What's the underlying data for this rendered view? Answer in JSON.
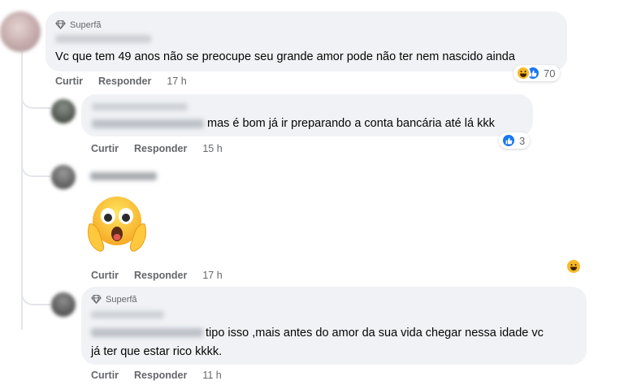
{
  "comments": [
    {
      "badge": "Superfã",
      "text": "Vc que tem 49 anos não se preocupe seu grande amor pode não ter nem nascido ainda",
      "actions": {
        "like": "Curtir",
        "reply": "Responder",
        "time": "17 h"
      },
      "reactions": {
        "icons": [
          "haha-icon",
          "like-icon"
        ],
        "count": "70"
      }
    },
    {
      "text": "mas é bom já ir preparando a conta bancária até lá kkk",
      "actions": {
        "like": "Curtir",
        "reply": "Responder",
        "time": "15 h"
      },
      "reactions": {
        "icons": [
          "like-icon"
        ],
        "count": "3"
      }
    },
    {
      "sticker": "shocked-face-emoji",
      "actions": {
        "like": "Curtir",
        "reply": "Responder",
        "time": "17 h"
      },
      "reactions": {
        "icons": [
          "haha-icon"
        ]
      }
    },
    {
      "badge": "Superfã",
      "text_line1": "tipo isso ,mais antes do amor da sua vida chegar nessa idade vc",
      "text_line2": "já ter que estar rico kkkk.",
      "actions": {
        "like": "Curtir",
        "reply": "Responder",
        "time": "11 h"
      }
    }
  ],
  "colors": {
    "bubble": "#f0f2f5",
    "secondary_text": "#65676b",
    "like_blue": "#1877f2",
    "haha_yellow": "#f7b928"
  }
}
